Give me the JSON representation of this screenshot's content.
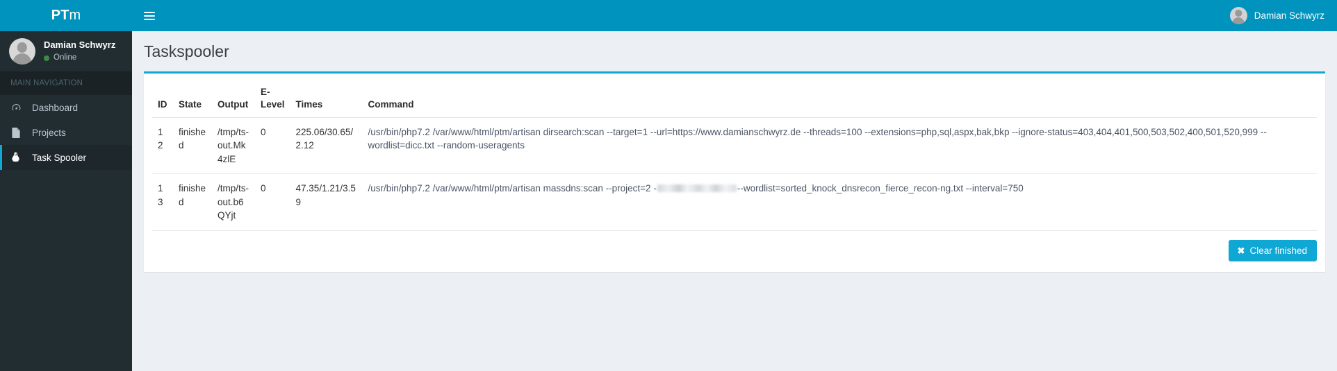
{
  "header": {
    "logo_bold": "PT",
    "logo_light": "m",
    "menu_toggle_label": "Toggle navigation",
    "user_name": "Damian Schwyrz"
  },
  "sidebar": {
    "user": {
      "name": "Damian Schwyrz",
      "status": "Online",
      "status_color": "#3c8c40"
    },
    "nav_header": "MAIN NAVIGATION",
    "items": [
      {
        "label": "Dashboard",
        "icon": "dashboard-icon",
        "active": false
      },
      {
        "label": "Projects",
        "icon": "file-icon",
        "active": false
      },
      {
        "label": "Task Spooler",
        "icon": "tux-icon",
        "active": true
      }
    ]
  },
  "main": {
    "page_title": "Taskspooler",
    "table": {
      "headers": [
        "ID",
        "State",
        "Output",
        "E-Level",
        "Times",
        "Command"
      ],
      "rows": [
        {
          "id": "12",
          "state": "finished",
          "output": "/tmp/ts-out.Mk4zlE",
          "elevel": "0",
          "times": "225.06/30.65/2.12",
          "command_before": "/usr/bin/php7.2 /var/www/html/ptm/artisan dirsearch:scan --target=1 --url=https://www.damianschwyrz.de --threads=100 --extensions=php,sql,aspx,bak,bkp --ignore-status=403,404,401,500,503,502,400,501,520,999 --wordlist=dicc.txt --random-useragents",
          "redacted": false,
          "command_after": ""
        },
        {
          "id": "13",
          "state": "finished",
          "output": "/tmp/ts-out.b6QYjt",
          "elevel": "0",
          "times": "47.35/1.21/3.59",
          "command_before": "/usr/bin/php7.2 /var/www/html/ptm/artisan massdns:scan --project=2 -",
          "redacted": true,
          "command_after": "--wordlist=sorted_knock_dnsrecon_fierce_recon-ng.txt --interval=750"
        }
      ]
    },
    "clear_button": {
      "icon": "close-x-icon",
      "label": "Clear finished"
    }
  },
  "colors": {
    "brand_header": "#0093bd",
    "accent_cyan": "#0fa7d4",
    "sidebar_dark": "#222d32",
    "sidebar_header_dark": "#1a2226",
    "content_bg": "#ecf0f5"
  }
}
